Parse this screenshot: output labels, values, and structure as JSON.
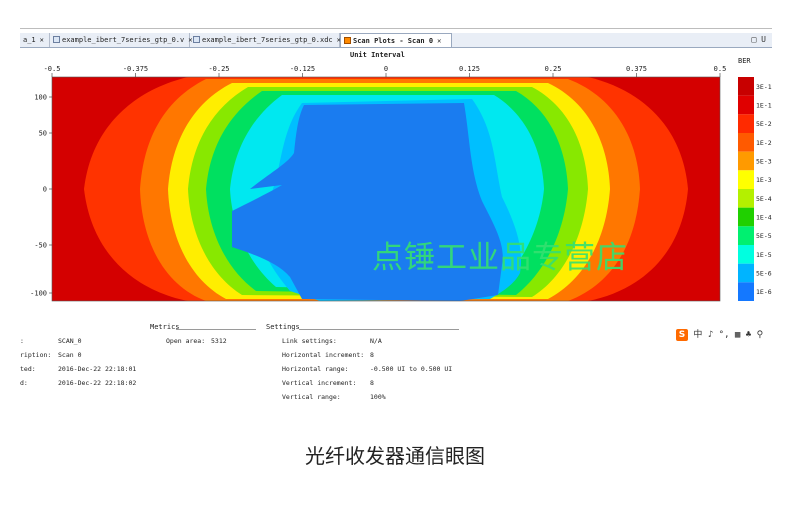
{
  "tabs": [
    {
      "label": "a_1",
      "active": false
    },
    {
      "label": "example_ibert_7series_gtp_0.v",
      "active": false
    },
    {
      "label": "example_ibert_7series_gtp_0.xdc",
      "active": false
    },
    {
      "label": "Scan Plots - Scan 0",
      "active": true
    }
  ],
  "window_controls": "□ U",
  "chart_data": {
    "type": "heatmap",
    "title": "Unit Interval",
    "x_ticks": [
      "-0.5",
      "-0.375",
      "-0.25",
      "-0.125",
      "0",
      "0.125",
      "0.25",
      "0.375",
      "0.5"
    ],
    "y_ticks": [
      "100",
      "50",
      "0",
      "-50",
      "-100"
    ],
    "xlim": [
      -0.5,
      0.5
    ],
    "ylim": [
      -100,
      100
    ],
    "legend_title": "BER",
    "legend": [
      {
        "label": "3E-1",
        "color": "#c80000"
      },
      {
        "label": "1E-1",
        "color": "#e00000"
      },
      {
        "label": "5E-2",
        "color": "#ff2a00"
      },
      {
        "label": "1E-2",
        "color": "#ff5a00"
      },
      {
        "label": "5E-3",
        "color": "#ff9a00"
      },
      {
        "label": "1E-3",
        "color": "#ffff00"
      },
      {
        "label": "5E-4",
        "color": "#b4f000"
      },
      {
        "label": "1E-4",
        "color": "#20d000"
      },
      {
        "label": "5E-5",
        "color": "#00f070"
      },
      {
        "label": "1E-5",
        "color": "#00ffe0"
      },
      {
        "label": "5E-6",
        "color": "#00b4ff"
      },
      {
        "label": "1E-6",
        "color": "#1478ff"
      }
    ],
    "contour_colors": {
      "c0": "#d40000",
      "c1": "#ff3300",
      "c2": "#ff7700",
      "c3": "#ffee00",
      "c4": "#88e800",
      "c5": "#00e060",
      "c6": "#00e8f0",
      "c7": "#00bfff",
      "c8": "#1a7cf0"
    }
  },
  "metrics": {
    "header": "Metrics",
    "open_area_label": "Open area:",
    "open_area_value": "5312"
  },
  "info": [
    {
      "label": ":",
      "value": "SCAN_0"
    },
    {
      "label": "ription:",
      "value": "Scan 0"
    },
    {
      "label": "ted:",
      "value": "2016-Dec-22 22:18:01"
    },
    {
      "label": "d:",
      "value": "2016-Dec-22 22:18:02"
    }
  ],
  "settings": {
    "header": "Settings",
    "rows": [
      {
        "label": "Link settings:",
        "value": "N/A"
      },
      {
        "label": "Horizontal increment:",
        "value": "8"
      },
      {
        "label": "Horizontal range:",
        "value": "-0.500 UI to 0.500 UI"
      },
      {
        "label": "Vertical increment:",
        "value": "8"
      },
      {
        "label": "Vertical range:",
        "value": "100%"
      }
    ]
  },
  "tray": {
    "logo": "S",
    "text": "中 ♪ °, ▦ ♣ ⚲"
  },
  "watermark": "点锤工业品专营店",
  "caption": "光纤收发器通信眼图"
}
